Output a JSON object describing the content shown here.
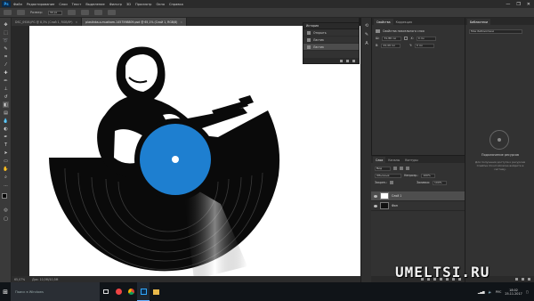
{
  "app": {
    "logo": "Ps",
    "menu": [
      "Файл",
      "Редактирование",
      "Слои",
      "Текст",
      "Выделение",
      "Фильтр",
      "3D",
      "Просмотр",
      "Окно",
      "Справка"
    ],
    "window_controls": [
      "—",
      "❐",
      "✕"
    ]
  },
  "options": {
    "size_label": "Размер:",
    "size_value": "30 px"
  },
  "tabs": [
    {
      "label": "DSC_0926.JPG @ 8,3% (Слой 1, RGB/8*)",
      "active": false
    },
    {
      "label": "plastinka-s-muzikom-1457598809.psd @ 65,1% (Слой 1, RGB/8)",
      "active": true
    }
  ],
  "history": {
    "title": "История",
    "items": [
      {
        "label": "Открыть",
        "active": false
      },
      {
        "label": "Ластик",
        "active": false
      },
      {
        "label": "Ластик",
        "active": true
      }
    ]
  },
  "properties": {
    "tabs": [
      "Свойства",
      "Коррекция"
    ],
    "header": "Свойства пиксельного слоя",
    "rows": [
      {
        "a": "Ш:",
        "a_val": "31,86 см",
        "b": "X:",
        "b_val": "0 см"
      },
      {
        "a": "В:",
        "a_val": "24,49 см",
        "b": "Y:",
        "b_val": "0 см"
      }
    ]
  },
  "layers": {
    "tabs": [
      "Слои",
      "Каналы",
      "Контуры"
    ],
    "filter": "Вид",
    "blend_mode": "Обычные",
    "opacity_label": "Непрозр.:",
    "opacity_value": "100%",
    "lock_label": "Закреп.:",
    "fill_label": "Заливка:",
    "fill_value": "100%",
    "items": [
      {
        "name": "Слой 1",
        "active": true
      },
      {
        "name": "Фон",
        "active": false
      }
    ]
  },
  "libraries": {
    "tab": "Библиотеки",
    "dropdown": "Мои библиотеки",
    "title": "Подключение ресурсов",
    "text": "Для получения доступа к ресурсам Creative Cloud Libraries войдите в систему."
  },
  "status": {
    "zoom": "65,07%",
    "doc": "Док: 10,5M/10,5M"
  },
  "taskbar": {
    "search": "Поиск в Windows",
    "tray_lang": "РУС",
    "time": "18:02",
    "date": "25.11.2017"
  },
  "watermark": "UMELTSI.RU",
  "colors": {
    "record_label": "#1e7fd0",
    "accent": "#31a8ff"
  }
}
